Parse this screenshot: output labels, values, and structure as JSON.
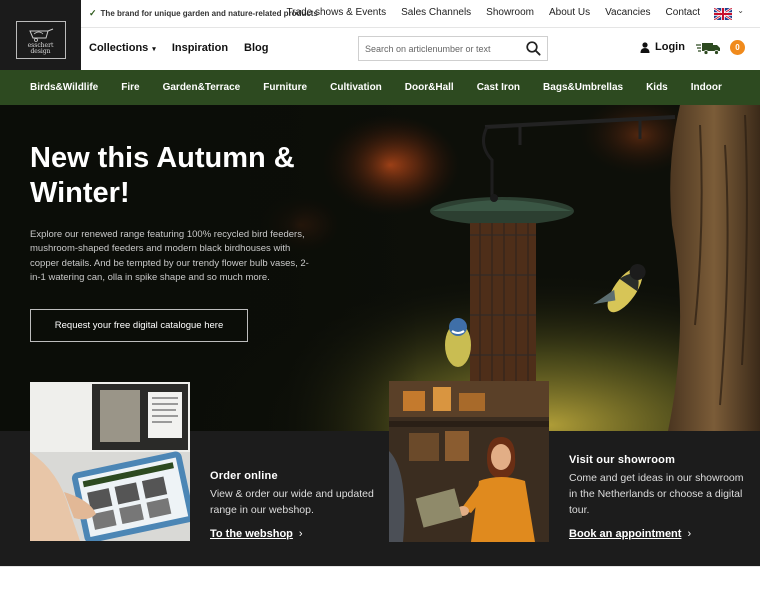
{
  "logo": {
    "alt_lines": [
      "esschert",
      "design"
    ]
  },
  "topbar": {
    "tagline": "The brand for unique garden and nature-related products",
    "links": [
      "Trade shows & Events",
      "Sales Channels",
      "Showroom",
      "About Us",
      "Vacancies",
      "Contact"
    ],
    "language_flag": "uk-flag-icon"
  },
  "mainnav": {
    "items": [
      "Collections",
      "Inspiration",
      "Blog"
    ],
    "search_placeholder": "Search on articlenumber or text",
    "login_label": "Login",
    "cart_count": "0"
  },
  "categories": [
    "Birds&Wildlife",
    "Fire",
    "Garden&Terrace",
    "Furniture",
    "Cultivation",
    "Door&Hall",
    "Cast Iron",
    "Bags&Umbrellas",
    "Kids",
    "Indoor"
  ],
  "hero": {
    "title": "New this Autumn & Winter!",
    "text": "Explore our renewed range featuring 100% recycled bird feeders, mushroom-shaped feeders and modern black birdhouses with copper details. And be tempted by our trendy flower bulb vases, 2-in-1 watering can, olla in spike shape and so much more.",
    "button": "Request your free digital catalogue here"
  },
  "promos": {
    "online": {
      "title": "Order online",
      "text": "View & order our wide and updated range in our webshop.",
      "link": "To the webshop"
    },
    "showroom": {
      "title": "Visit our showroom",
      "text": "Come and get ideas in our showroom in the Netherlands or choose a digital tour.",
      "link": "Book an appointment"
    }
  },
  "colors": {
    "brand_green": "#2d4a20",
    "accent_orange": "#f08a1c",
    "dark_band": "#1c1c1c"
  }
}
